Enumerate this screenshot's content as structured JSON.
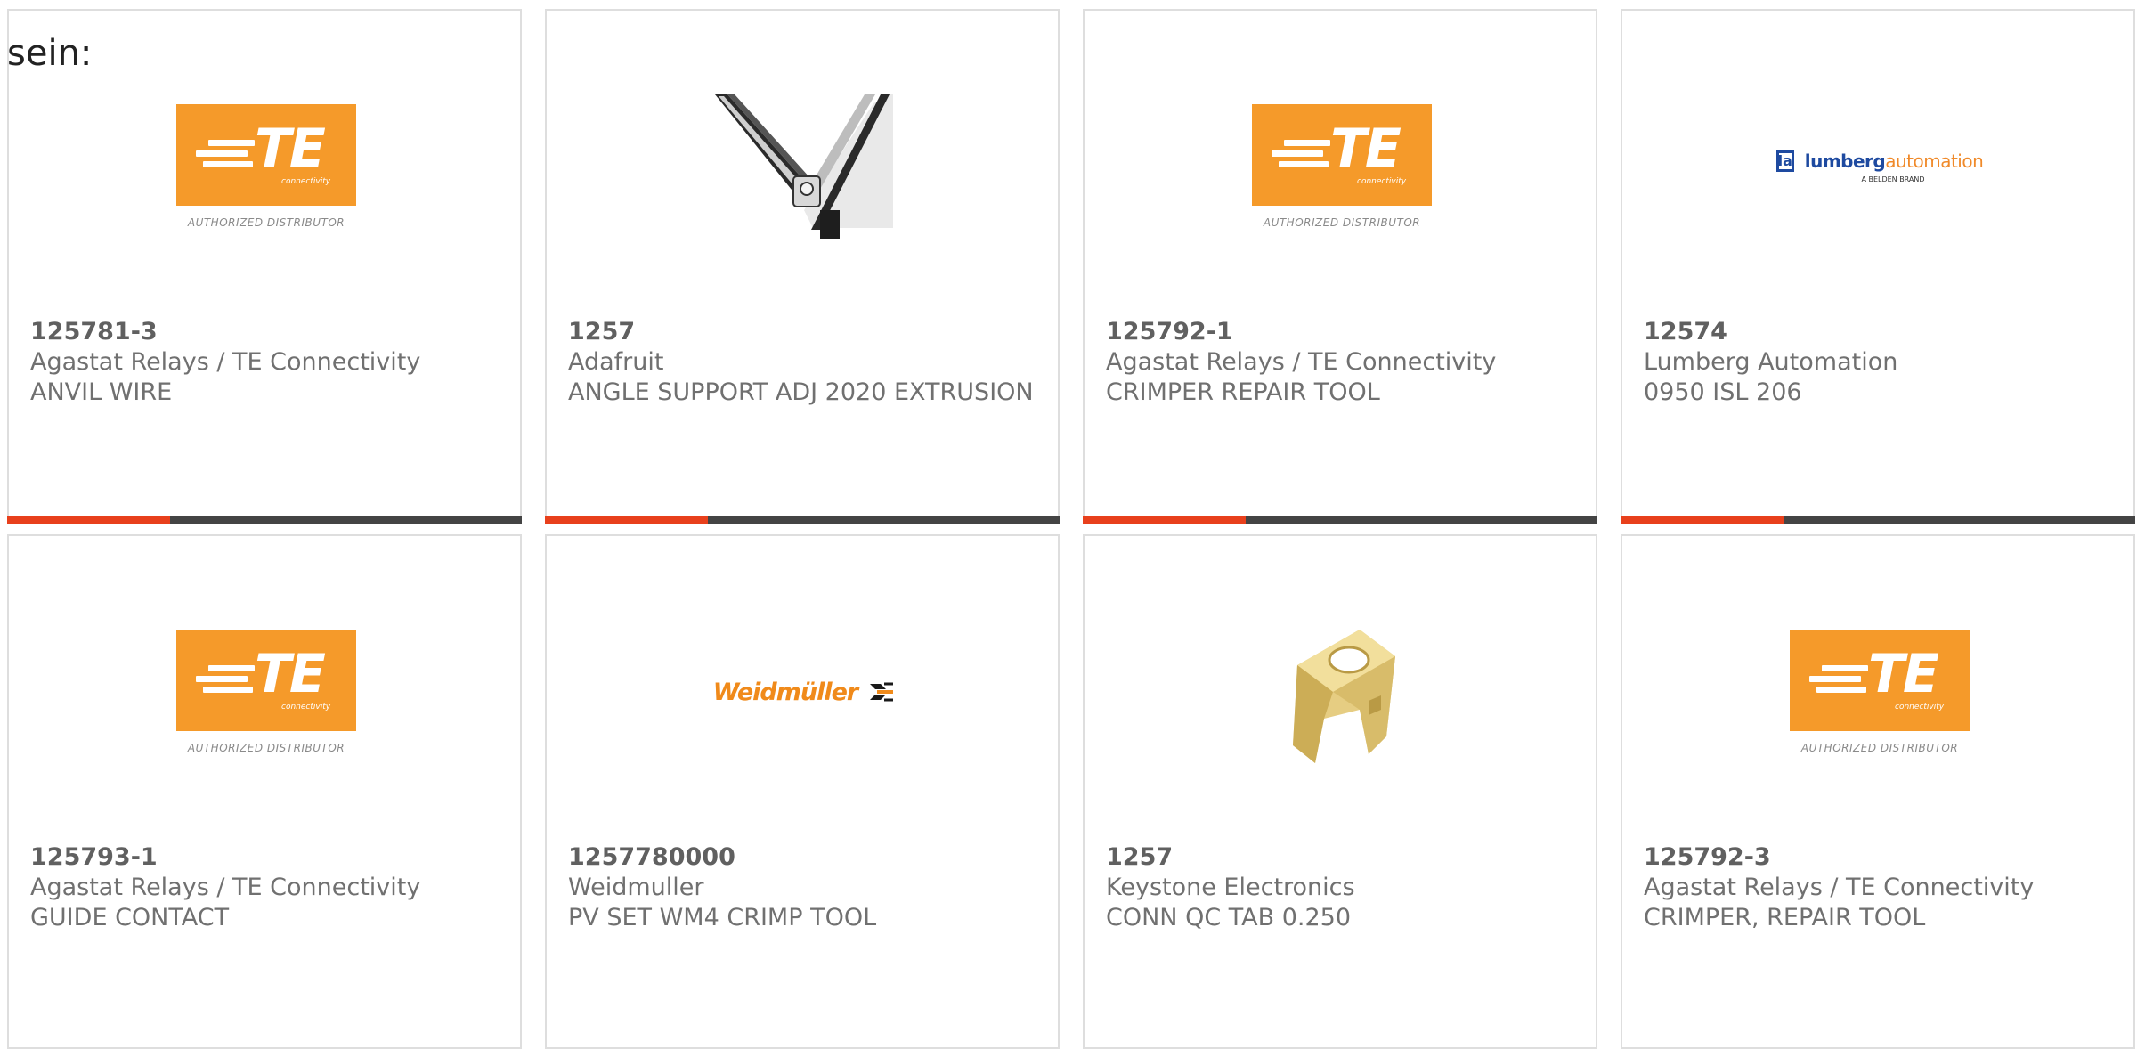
{
  "intro": "sein:",
  "brands": {
    "te_caption": "AUTHORIZED DISTRIBUTOR",
    "te_word": "TE",
    "te_sub": "connectivity",
    "lumberg_mark": "la",
    "lumberg_name": "lumberg",
    "lumberg_auto": "automation",
    "lumberg_tag": "A BELDEN BRAND",
    "weidmuller_name": "Weidmüller"
  },
  "colors": {
    "accent": "#e8401c",
    "bar": "#444444",
    "te_orange": "#f59a2a",
    "text": "#707070"
  },
  "products": [
    {
      "pn": "125781-3",
      "mfr": "Agastat Relays / TE Connectivity",
      "desc": "ANVIL WIRE",
      "image": "te-logo"
    },
    {
      "pn": "1257",
      "mfr": "Adafruit",
      "desc": "ANGLE SUPPORT ADJ 2020 EXTRUSION",
      "image": "angle-support-photo"
    },
    {
      "pn": "125792-1",
      "mfr": "Agastat Relays / TE Connectivity",
      "desc": "CRIMPER REPAIR TOOL",
      "image": "te-logo"
    },
    {
      "pn": "12574",
      "mfr": "Lumberg Automation",
      "desc": "0950 ISL 206",
      "image": "lumberg-logo"
    },
    {
      "pn": "125793-1",
      "mfr": "Agastat Relays / TE Connectivity",
      "desc": "GUIDE CONTACT",
      "image": "te-logo"
    },
    {
      "pn": "1257780000",
      "mfr": "Weidmuller",
      "desc": "PV SET WM4 CRIMP TOOL",
      "image": "weidmuller-logo"
    },
    {
      "pn": "1257",
      "mfr": "Keystone Electronics",
      "desc": "CONN QC TAB 0.250",
      "image": "qc-tab-photo"
    },
    {
      "pn": "125792-3",
      "mfr": "Agastat Relays / TE Connectivity",
      "desc": "CRIMPER, REPAIR TOOL",
      "image": "te-logo"
    }
  ]
}
